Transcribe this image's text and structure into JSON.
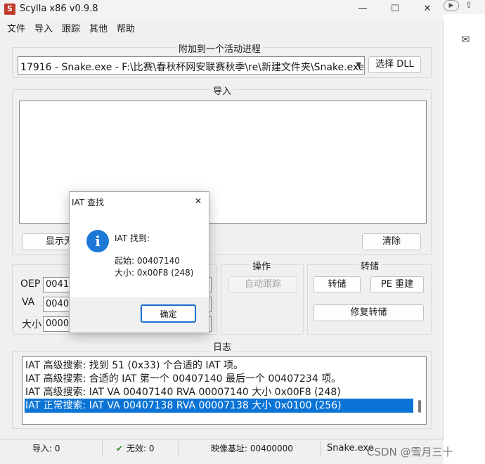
{
  "window": {
    "title": "Scylla x86 v0.9.8",
    "logo_letter": "S",
    "minimize": "—",
    "maximize": "☐",
    "close": "✕"
  },
  "menu": [
    "文件",
    "导入",
    "跟踪",
    "其他",
    "帮助"
  ],
  "attach": {
    "group_title": "附加到一个活动进程",
    "process": "17916 - Snake.exe - F:\\比赛\\春秋杯网安联赛秋季\\re\\新建文件夹\\Snake.exe",
    "select_dll": "选择 DLL"
  },
  "imports": {
    "group_title": "导入",
    "show_invalid": "显示无效",
    "clear": "清除"
  },
  "iat_fields": {
    "oep_label": "OEP",
    "oep_value": "0041",
    "va_label": "VA",
    "va_value": "0040",
    "size_label": "大小",
    "size_value": "0000"
  },
  "actions": {
    "group_title": "操作",
    "auto_trace": "自动跟踪"
  },
  "dump": {
    "group_title": "转储",
    "dump": "转储",
    "pe_rebuild": "PE 重建",
    "fix_dump": "修复转储"
  },
  "log": {
    "group_title": "日志",
    "lines": [
      "IAT 高级搜索: 找到 51 (0x33) 个合适的 IAT 项。",
      "IAT 高级搜索: 合适的 IAT 第一个 00407140 最后一个 00407234 项。",
      "IAT 高级搜索: IAT VA 00407140 RVA 00007140 大小 0x00F8 (248)",
      "IAT 正常搜索: IAT VA 00407138 RVA 00007138 大小 0x0100 (256)"
    ],
    "selected_index": 3
  },
  "status": {
    "imports": "导入: 0",
    "invalid_icon": "✔",
    "invalid": "无效: 0",
    "image_base": "映像基址: 00400000",
    "module": "Snake.exe"
  },
  "dialog": {
    "title": "IAT 查找",
    "close": "✕",
    "icon": "i",
    "heading": "IAT 找到:",
    "start": "起始: 00407140",
    "size": "大小: 0x00F8 (248)",
    "ok": "确定"
  },
  "watermark": "CSDN @雪月三十",
  "sidebar_icons": [
    "play-icon",
    "comment-icon",
    "share-icon"
  ],
  "sidebar_glyphs": {
    "play": "▶",
    "comment": "✉",
    "share": "⇪"
  }
}
